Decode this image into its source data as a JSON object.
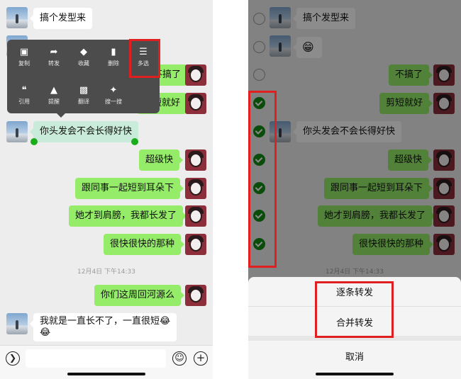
{
  "left": {
    "messages": {
      "m1": "搞个发型来",
      "m2": "不搞了",
      "m3": "剪短就好",
      "m4": "你头发会不会长得好快",
      "m5": "超级快",
      "m6": "跟同事一起短到耳朵下",
      "m7": "她才到肩膀，我都长发了",
      "m8": "很快很快的那种",
      "m9": "你们这周回河源么",
      "m10": "我就是一直长不了，一直很短😂",
      "m10b": "😂"
    },
    "timestamp": "12月4日 下午14:33",
    "menu": {
      "copy": "复制",
      "forward": "转发",
      "favorite": "收藏",
      "delete": "删除",
      "multiselect": "多选",
      "quote": "引用",
      "remind": "提醒",
      "translate": "翻译",
      "search": "搜一搜"
    }
  },
  "right": {
    "messages": {
      "m1": "搞个发型来",
      "m2": "不搞了",
      "m3": "剪短就好",
      "m4": "你头发会不会长得好快",
      "m5": "超级快",
      "m6": "跟同事一起短到耳朵下",
      "m7": "她才到肩膀，我都长发了",
      "m8": "很快很快的那种"
    },
    "timestamp": "12月4日 下午14:33",
    "sheet": {
      "one_by_one": "逐条转发",
      "merge": "合并转发",
      "cancel": "取消"
    }
  },
  "icons": [
    "voice-icon",
    "emoji-icon",
    "plus-icon",
    "checkbox-icon"
  ],
  "colors": {
    "bubble_green": "#95ec69",
    "highlight_red": "#e02020",
    "check_green": "#138a13"
  }
}
